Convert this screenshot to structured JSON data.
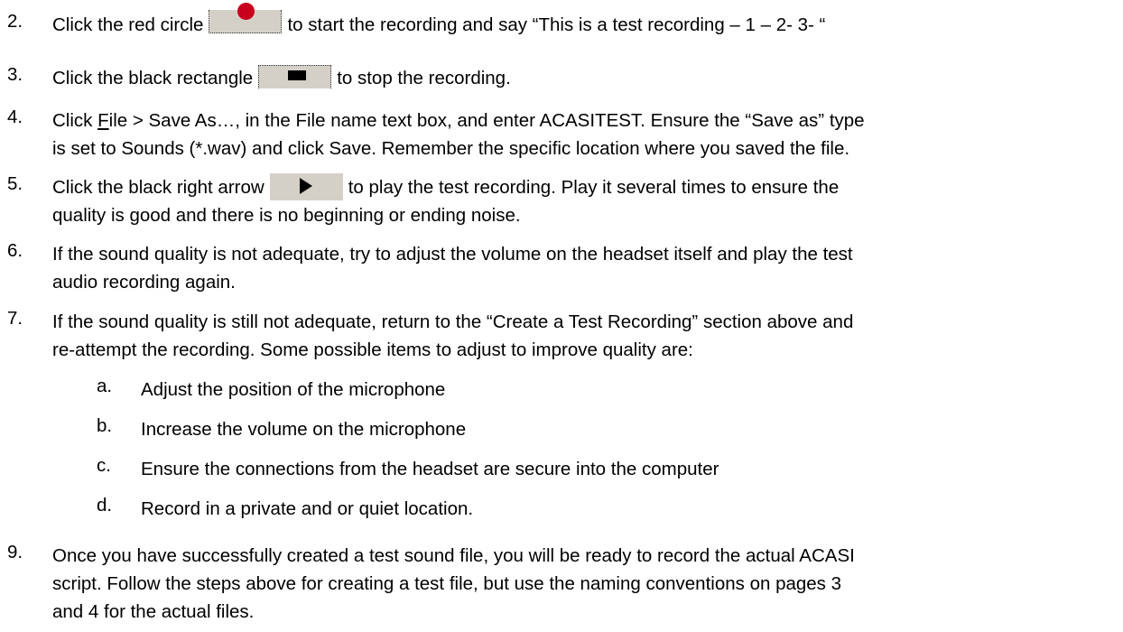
{
  "steps": [
    {
      "num": "2.",
      "a": "Click the red circle",
      "b": "to start the recording and say “This is a test recording – 1 – 2- 3- “",
      "icon": "record-icon"
    },
    {
      "num": "3.",
      "a": "Click the black rectangle",
      "b": "to stop the recording.",
      "icon": "stop-icon"
    },
    {
      "num": "4.",
      "pre": "Click ",
      "file_u": "F",
      "file_rest": "ile > Save As…, in the File name text box, and enter ACASITEST. Ensure the “Save as” type",
      "line2": "is set to Sounds (*.wav) and click Save.  Remember the specific location where you saved the file."
    },
    {
      "num": "5.",
      "a": "Click the black right arrow",
      "b": "to play the test recording.  Play it several times to ensure the",
      "line2": "quality is good and there is no beginning or ending noise.",
      "icon": "play-icon"
    },
    {
      "num": "6.",
      "line1": "If the sound quality is not adequate, try to adjust the volume on the headset itself and play the test",
      "line2": "audio recording again."
    },
    {
      "num": "7.",
      "line1": "If the sound quality is still not adequate, return to the “Create a Test Recording” section above and",
      "line2": "re-attempt the recording.  Some possible items to adjust to improve quality are:"
    },
    {
      "num": "9.",
      "line1": "Once you have successfully created a test sound file, you will be ready to record the actual ACASI",
      "line2": "script. Follow the steps above for creating a test file, but use the naming conventions on pages 3",
      "line3": "and 4 for the actual files."
    }
  ],
  "subitems": [
    {
      "letter": "a.",
      "text": "Adjust the position of the microphone"
    },
    {
      "letter": "b.",
      "text": "Increase the volume on the microphone"
    },
    {
      "letter": "c.",
      "text": "Ensure the connections from the headset are secure into the computer"
    },
    {
      "letter": "d.",
      "text": "Record in a private and or quiet location."
    }
  ]
}
